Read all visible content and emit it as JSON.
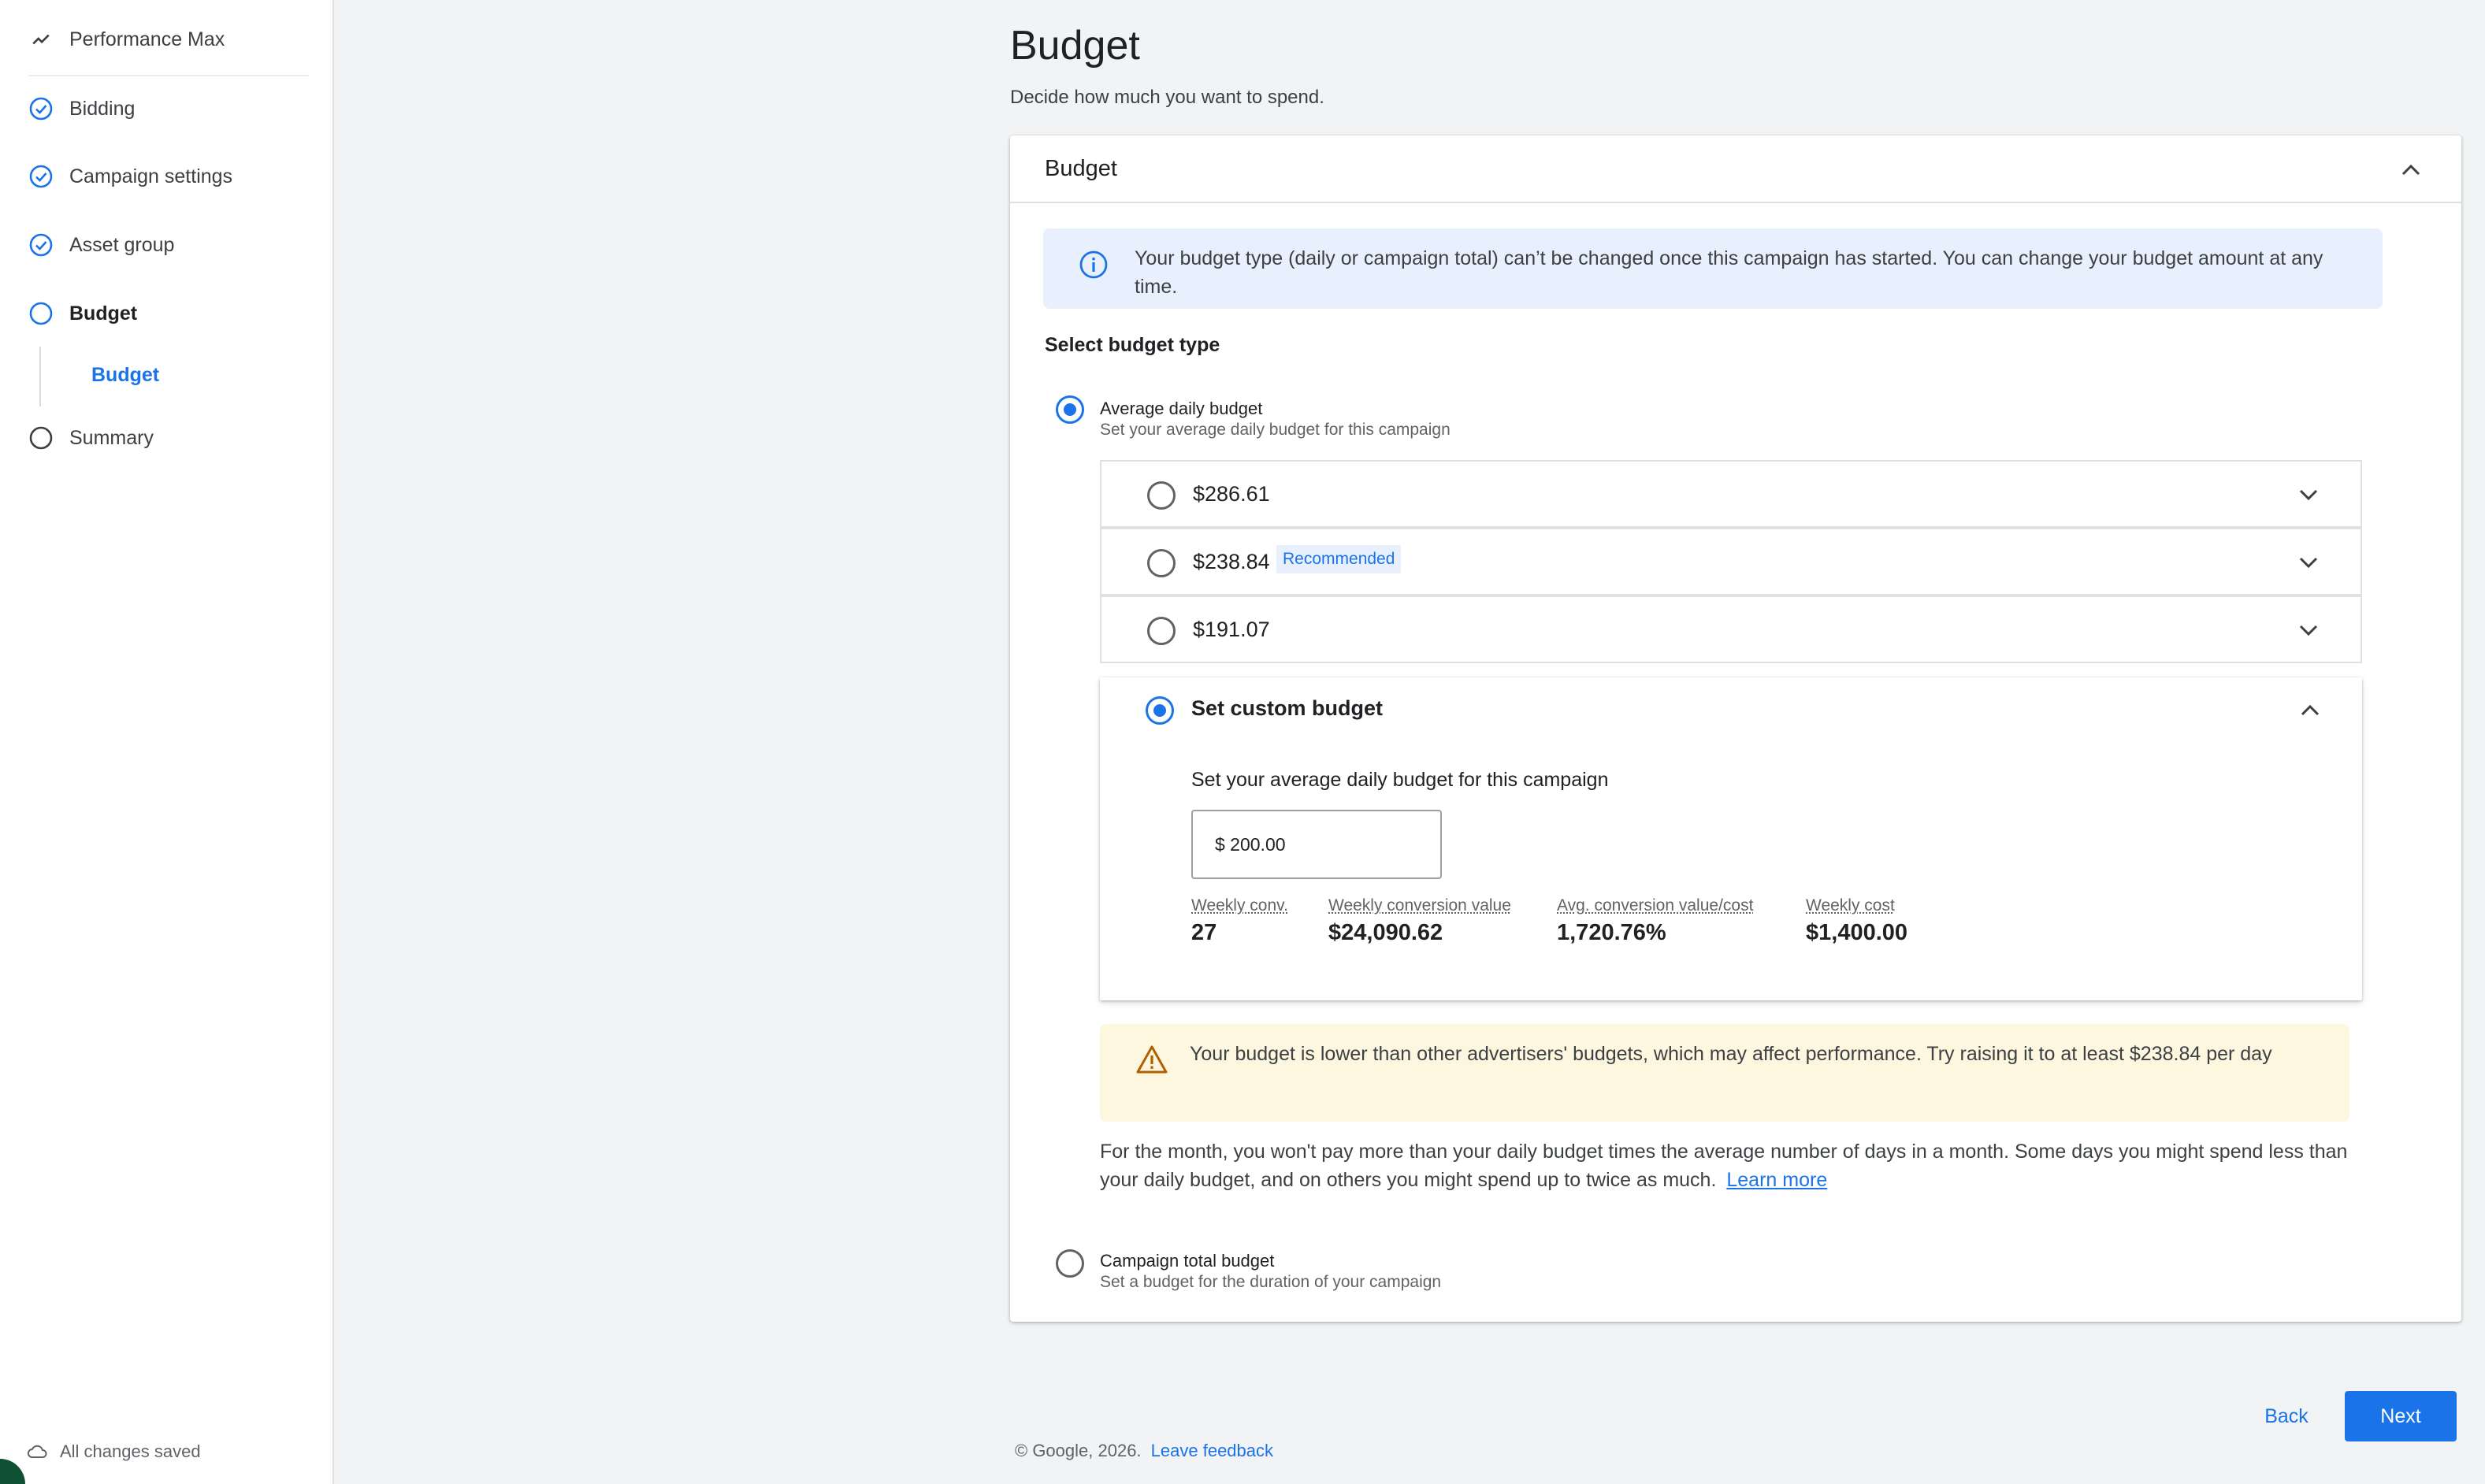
{
  "sidebar": {
    "items": [
      {
        "label": "Performance Max",
        "icon": "trend-icon"
      },
      {
        "label": "Bidding",
        "icon": "check-circle-icon"
      },
      {
        "label": "Campaign settings",
        "icon": "check-circle-icon"
      },
      {
        "label": "Asset group",
        "icon": "check-circle-icon"
      },
      {
        "label": "Budget",
        "icon": "empty-circle-icon"
      },
      {
        "label": "Summary",
        "icon": "empty-circle-icon"
      }
    ],
    "sub_item": "Budget",
    "saved_status": "All changes saved"
  },
  "page": {
    "title": "Budget",
    "subtitle": "Decide how much you want to spend."
  },
  "card": {
    "title": "Budget",
    "info": "Your budget type (daily or campaign total) can’t be changed once this campaign has started. You can change your budget amount at any time.",
    "select_label": "Select budget type",
    "daily": {
      "label": "Average daily budget",
      "desc": "Set your average daily budget for this campaign"
    },
    "options": [
      {
        "amount": "$286.61",
        "badge": ""
      },
      {
        "amount": "$238.84",
        "badge": "Recommended"
      },
      {
        "amount": "$191.07",
        "badge": ""
      }
    ],
    "custom": {
      "label": "Set custom budget",
      "sub": "Set your average daily budget for this campaign",
      "value": "$ 200.00",
      "stats": [
        {
          "key": "Weekly conv.",
          "value": "27"
        },
        {
          "key": "Weekly conversion value",
          "value": "$24,090.62"
        },
        {
          "key": "Avg. conversion value/cost",
          "value": "1,720.76%"
        },
        {
          "key": "Weekly cost",
          "value": "$1,400.00"
        }
      ]
    },
    "warning": "Your budget is lower than other advertisers' budgets, which may affect performance. Try raising it to at least $238.84 per day",
    "month_note": "For the month, you won't pay more than your daily budget times the average number of days in a month. Some days you might spend less than your daily budget, and on others you might spend up to twice as much.",
    "learn_more": "Learn more",
    "total": {
      "label": "Campaign total budget",
      "desc": "Set a budget for the duration of your campaign"
    }
  },
  "footer": {
    "copyright": "© Google, 2026.",
    "feedback": "Leave feedback"
  },
  "buttons": {
    "back": "Back",
    "next": "Next"
  },
  "colors": {
    "accent": "#1a73e8",
    "info_bg": "#e8f0fe",
    "warn_bg": "#fef7e0",
    "warn_icon": "#b06000"
  }
}
